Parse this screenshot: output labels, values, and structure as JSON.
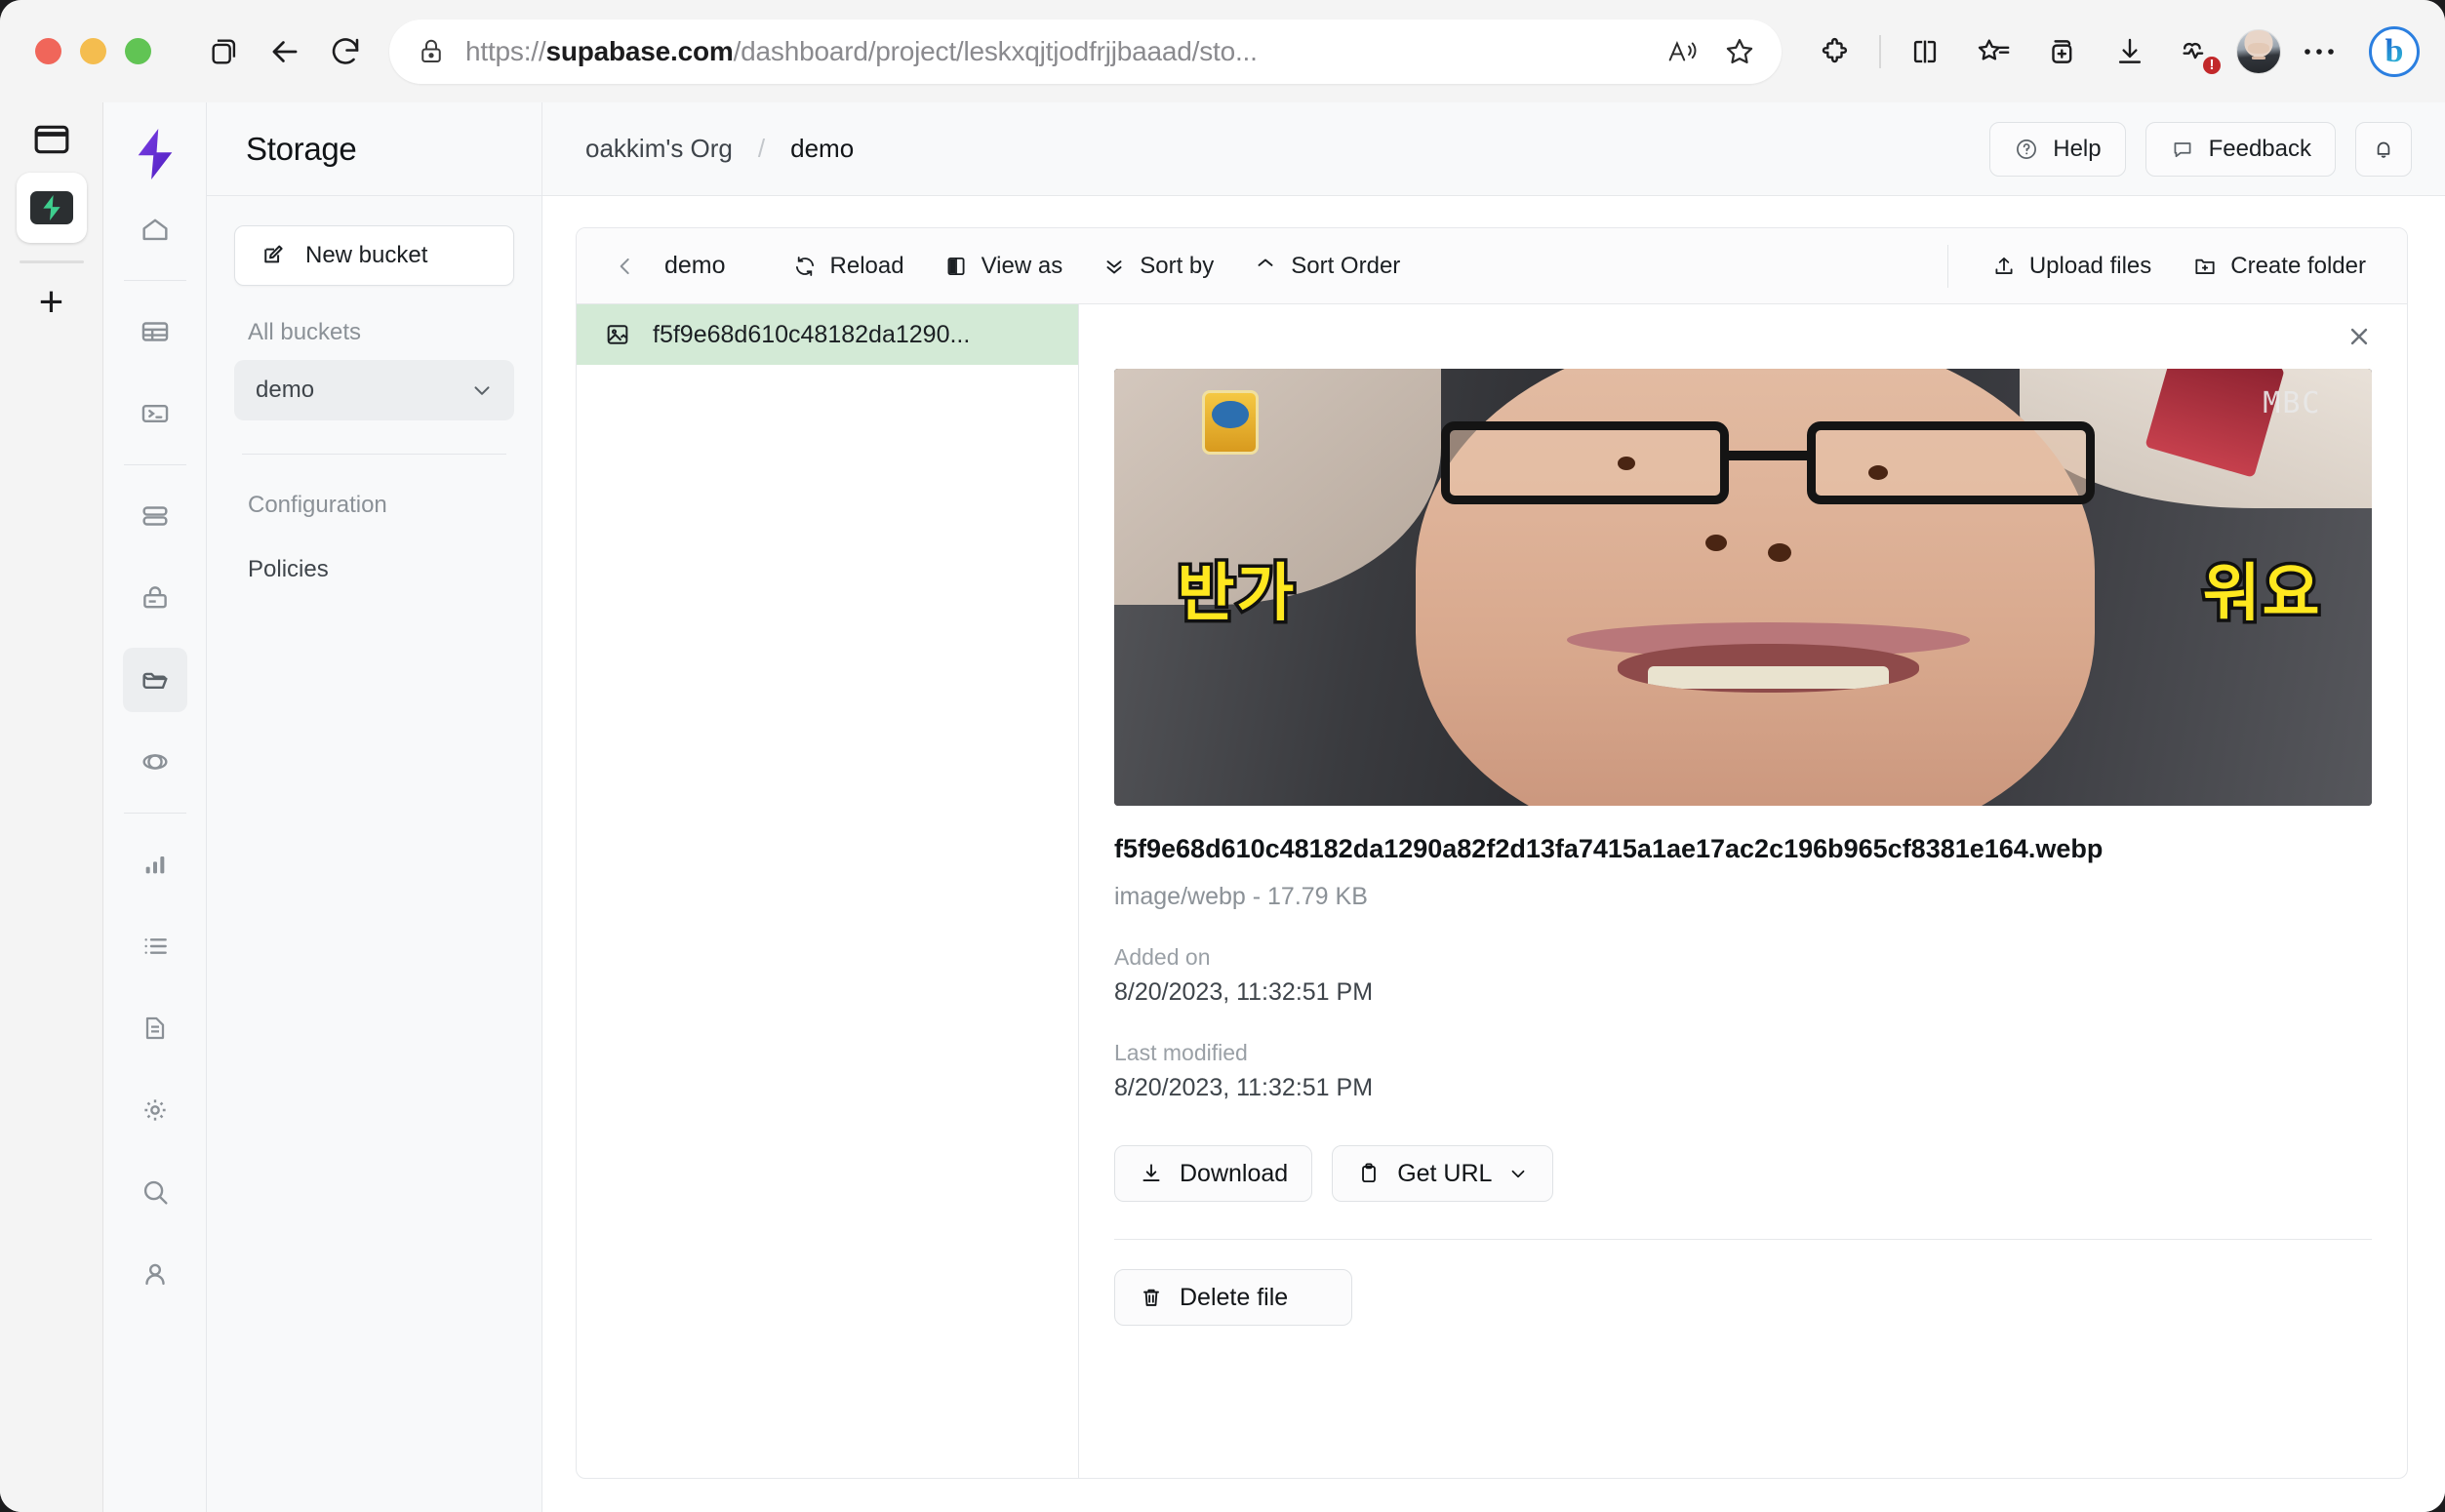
{
  "browser": {
    "url_full": "https://supabase.com/dashboard/project/leskxqjtjodfrjjbaaad/sto...",
    "url_prefix": "https://",
    "url_host": "supabase.com",
    "url_path": "/dashboard/project/leskxqjtjodfrjjbaaad/sto...",
    "lock_icon": "lock-icon",
    "read_aloud_icon": "read-aloud-icon",
    "favorite_icon": "star-icon",
    "back_icon": "back-arrow-icon",
    "reload_icon": "reload-icon",
    "tab_preview_icon": "tab-preview-icon",
    "extensions_icon": "extensions-puzzle-icon",
    "split_screen_icon": "split-screen-icon",
    "favorites_icon": "favorites-star-list-icon",
    "collections_icon": "collections-icon",
    "downloads_icon": "downloads-icon",
    "health_icon": "browser-essentials-icon",
    "health_badge": "!",
    "profile_icon": "profile-avatar",
    "settings_icon": "more-options-icon",
    "copilot_icon": "bing-copilot-icon"
  },
  "edge_strip": {
    "pane_icon": "toggle-pane-icon",
    "tab_icon": "supabase-favicon",
    "add_tab_label": "+"
  },
  "rail": {
    "logo": "supabase-logo",
    "items": [
      {
        "name": "home-icon",
        "label": "Home"
      },
      {
        "name": "table-editor-icon",
        "label": "Table Editor"
      },
      {
        "name": "sql-editor-icon",
        "label": "SQL Editor"
      },
      {
        "name": "database-icon",
        "label": "Database"
      },
      {
        "name": "auth-icon",
        "label": "Authentication"
      },
      {
        "name": "storage-icon",
        "label": "Storage",
        "active": true
      },
      {
        "name": "edge-functions-icon",
        "label": "Edge Functions"
      },
      {
        "name": "reports-icon",
        "label": "Reports"
      },
      {
        "name": "logs-icon",
        "label": "Logs"
      },
      {
        "name": "docs-icon",
        "label": "API Docs"
      },
      {
        "name": "settings-icon",
        "label": "Project Settings"
      },
      {
        "name": "search-icon",
        "label": "Search"
      },
      {
        "name": "account-icon",
        "label": "Account"
      }
    ]
  },
  "storage_panel": {
    "title": "Storage",
    "new_bucket_label": "New bucket",
    "new_bucket_icon": "edit-square-icon",
    "all_buckets_label": "All buckets",
    "bucket_name": "demo",
    "bucket_chevron": "chevron-down-icon",
    "configuration_label": "Configuration",
    "policies_label": "Policies"
  },
  "topbar": {
    "breadcrumb_org": "oakkim's Org",
    "breadcrumb_sep": "/",
    "breadcrumb_project": "demo",
    "help_label": "Help",
    "help_icon": "question-circle-icon",
    "feedback_label": "Feedback",
    "feedback_icon": "chat-bubble-icon",
    "notifications_icon": "bell-icon"
  },
  "explorer": {
    "back_icon": "chevron-left-icon",
    "path": "demo",
    "reload_label": "Reload",
    "reload_icon": "reload-icon",
    "view_as_label": "View as",
    "view_as_icon": "columns-icon",
    "sort_by_label": "Sort by",
    "sort_by_icon": "chevrons-down-icon",
    "sort_order_label": "Sort Order",
    "sort_order_icon": "chevrons-up-icon",
    "upload_label": "Upload files",
    "upload_icon": "upload-icon",
    "create_folder_label": "Create folder",
    "create_folder_icon": "folder-plus-icon",
    "files": [
      {
        "display_name": "f5f9e68d610c48182da1290...",
        "icon": "image-file-icon",
        "selected": true
      }
    ]
  },
  "detail": {
    "close_icon": "close-icon",
    "preview_icon": "image-preview",
    "preview_text_left": "반가",
    "preview_text_right": "워요",
    "preview_watermark": "MBC",
    "file_name": "f5f9e68d610c48182da1290a82f2d13fa7415a1ae17ac2c196b965cf8381e164.webp",
    "file_meta": "image/webp - 17.79 KB",
    "added_on_label": "Added on",
    "added_on_value": "8/20/2023, 11:32:51 PM",
    "last_modified_label": "Last modified",
    "last_modified_value": "8/20/2023, 11:32:51 PM",
    "download_label": "Download",
    "download_icon": "download-icon",
    "get_url_label": "Get URL",
    "get_url_icon": "clipboard-icon",
    "get_url_chevron": "chevron-down-icon",
    "delete_label": "Delete file",
    "delete_icon": "trash-icon"
  },
  "colors": {
    "selected_row": "#d3ead6",
    "supabase_green": "#3ecf8e",
    "supabase_purple": "#6d28d9",
    "panel_bg": "#f8f9fa",
    "border": "#e6e8eb",
    "accent_yellow": "#ffe81f"
  }
}
